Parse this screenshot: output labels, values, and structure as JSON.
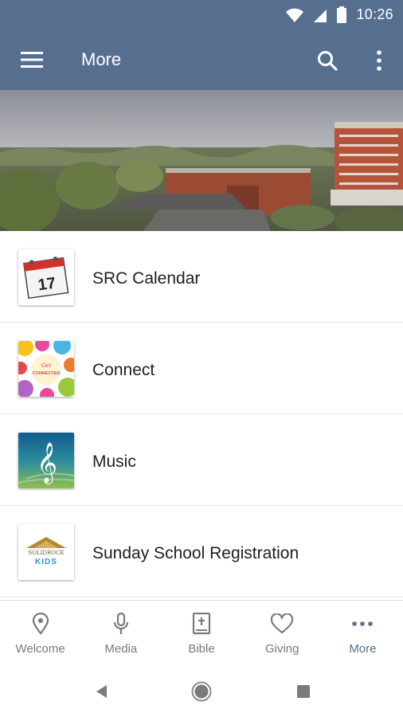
{
  "status_bar": {
    "time": "10:26",
    "icons": [
      "wifi-icon",
      "signal-icon",
      "battery-icon"
    ]
  },
  "app_bar": {
    "title": "More",
    "icons": [
      "menu-icon",
      "search-icon",
      "overflow-icon"
    ]
  },
  "colors": {
    "brand": "#566f8f",
    "inactive": "#7a7a7a",
    "divider": "#e6e6e6"
  },
  "list": {
    "items": [
      {
        "label": "SRC Calendar",
        "thumb": {
          "text": "17",
          "icon": "calendar-thumb"
        }
      },
      {
        "label": "Connect",
        "thumb": {
          "text": "Get CONNECTED",
          "icon": "connect-thumb"
        }
      },
      {
        "label": "Music",
        "thumb": {
          "icon": "music-thumb"
        }
      },
      {
        "label": "Sunday School Registration",
        "thumb": {
          "text": "SOLIDROCK",
          "subtext": "KIDS",
          "icon": "kids-thumb"
        }
      }
    ]
  },
  "bottom_nav": {
    "items": [
      {
        "label": "Welcome",
        "icon": "location-pin-icon",
        "active": false
      },
      {
        "label": "Media",
        "icon": "microphone-icon",
        "active": false
      },
      {
        "label": "Bible",
        "icon": "bible-icon",
        "active": false
      },
      {
        "label": "Giving",
        "icon": "heart-icon",
        "active": false
      },
      {
        "label": "More",
        "icon": "more-dots-icon",
        "active": true
      }
    ]
  },
  "system_nav": {
    "buttons": [
      "back-icon",
      "home-icon",
      "recents-icon"
    ]
  }
}
